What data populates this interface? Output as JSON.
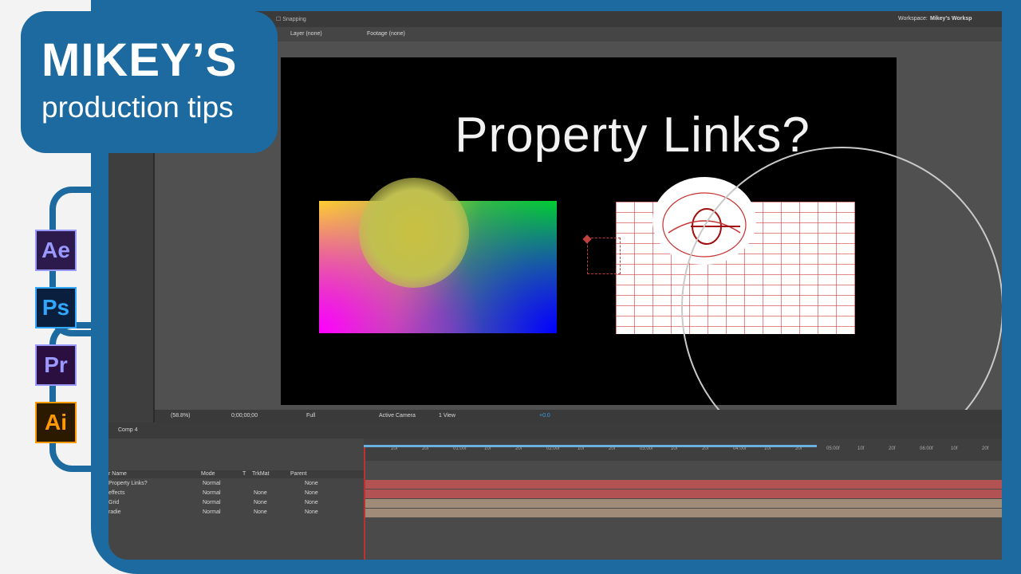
{
  "branding": {
    "title": "MIKEY’S",
    "subtitle": "production tips",
    "apps": [
      {
        "label": "Ae",
        "icon": "after-effects-icon",
        "color": "#9999ff",
        "bg": "#2d1a4d"
      },
      {
        "label": "Ps",
        "icon": "photoshop-icon",
        "color": "#31a8ff",
        "bg": "#0a1f3d"
      },
      {
        "label": "Pr",
        "icon": "premiere-icon",
        "color": "#9999ff",
        "bg": "#2a0f40"
      },
      {
        "label": "Ai",
        "icon": "illustrator-icon",
        "color": "#ff9a00",
        "bg": "#2b1900"
      }
    ],
    "frame_color": "#1d6aa0"
  },
  "app": {
    "toolbar": {
      "snapping": "Snapping"
    },
    "workspace": {
      "label": "Workspace:",
      "value": "Mikey's Worksp"
    },
    "panel_tabs": {
      "layer": "Layer (none)",
      "footage": "Footage (none)"
    },
    "composition": {
      "title": "Property Links?"
    },
    "viewer_bar": {
      "zoom": "(58.8%)",
      "timecode": "0;00;00;00",
      "resolution": "Full",
      "camera": "Active Camera",
      "views": "1 View",
      "exposure": "+0.0"
    },
    "timeline": {
      "tab": "Comp 4",
      "columns": {
        "name": "r Name",
        "mode": "Mode",
        "t": "T",
        "trkmat": "TrkMat",
        "parent": "Parent"
      },
      "layers": [
        {
          "name": "Property Links?",
          "mode": "Normal",
          "trkmat": "",
          "parent": "None",
          "color": "#b25252"
        },
        {
          "name": "effects",
          "mode": "Normal",
          "trkmat": "None",
          "parent": "None",
          "color": "#b25252"
        },
        {
          "name": "Grid",
          "mode": "Normal",
          "trkmat": "None",
          "parent": "None",
          "color": "#a08b78"
        },
        {
          "name": "radie",
          "mode": "Normal",
          "trkmat": "None",
          "parent": "None",
          "color": "#a08b78"
        }
      ],
      "ruler_labels": [
        "10f",
        "20f",
        "01:00f",
        "10f",
        "20f",
        "02:00f",
        "10f",
        "20f",
        "03:00f",
        "10f",
        "20f",
        "04:00f",
        "10f",
        "20f",
        "05:00f",
        "10f",
        "20f",
        "06:00f",
        "10f",
        "20f"
      ]
    }
  }
}
